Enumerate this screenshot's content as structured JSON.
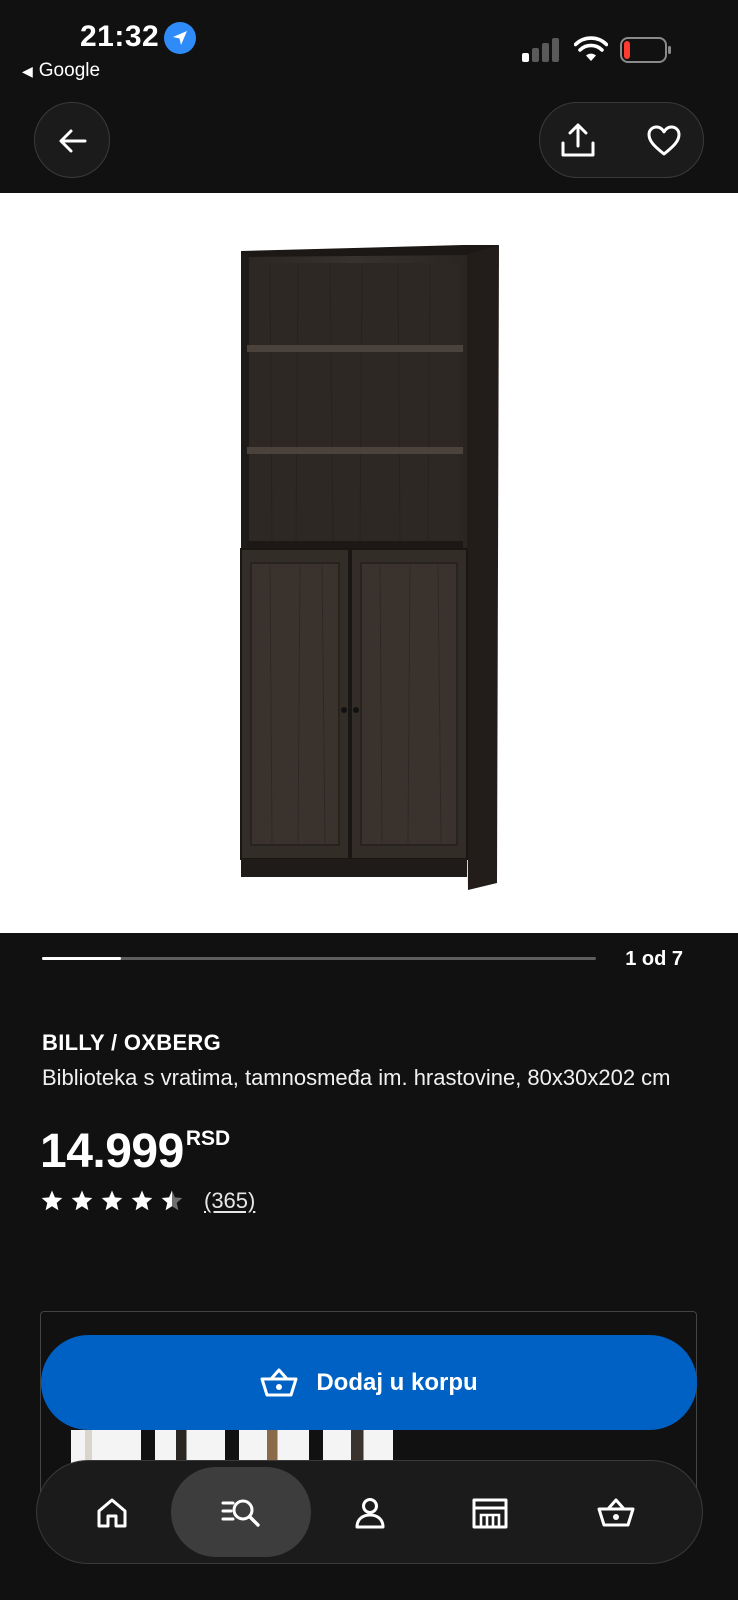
{
  "status_bar": {
    "time": "21:32",
    "back_app": "Google",
    "back_app_icon": "triangle-left-icon",
    "location_icon": "location-arrow-icon",
    "signal_bars_active": 1,
    "signal_bars_total": 4,
    "battery_level": 0.1,
    "battery_color": "#ff3b30"
  },
  "header": {
    "back_icon": "arrow-left-icon",
    "share_icon": "share-icon",
    "favorite_icon": "heart-icon"
  },
  "carousel": {
    "counter": "1 od 7",
    "current": 1,
    "total": 7
  },
  "product": {
    "name": "BILLY / OXBERG",
    "description": "Biblioteka s vratima, tamnosmeđa im. hrastovine, 80x30x202 cm",
    "price": "14.999",
    "currency": "RSD",
    "rating": 4.5,
    "rating_max": 5,
    "review_count": "(365)"
  },
  "cta": {
    "add_to_cart": "Dodaj u korpu",
    "icon": "basket-icon",
    "color": "#0061c5"
  },
  "bottom_nav": {
    "items": [
      {
        "icon": "home-icon",
        "active": false
      },
      {
        "icon": "search-list-icon",
        "active": true
      },
      {
        "icon": "profile-icon",
        "active": false
      },
      {
        "icon": "store-icon",
        "active": false
      },
      {
        "icon": "basket-icon",
        "active": false
      }
    ]
  }
}
